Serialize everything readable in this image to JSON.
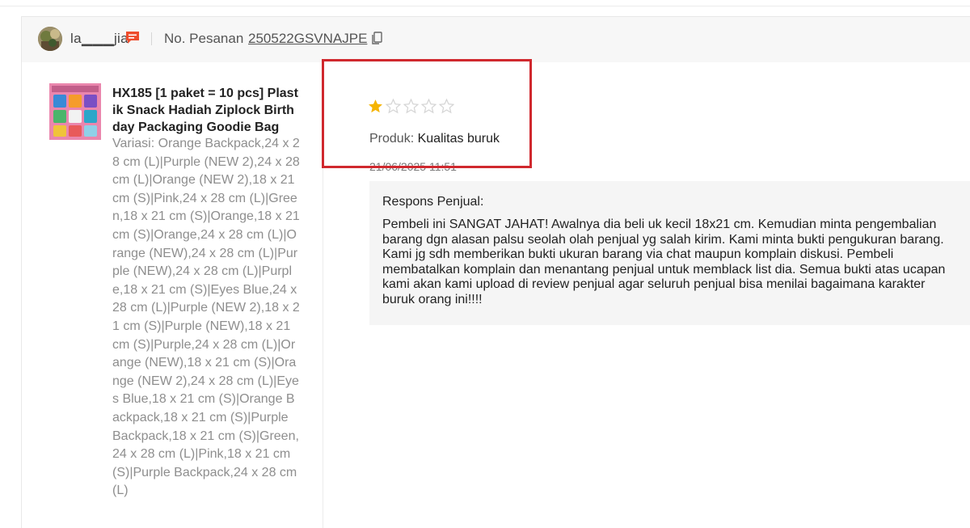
{
  "review": {
    "buyer": {
      "name": "la▁▁▁jia",
      "avatar_icon": "avatar-photo",
      "chat_icon": "chat-bubble-icon"
    },
    "order": {
      "label": "No. Pesanan",
      "number": "250522GSVNAJPE",
      "copy_icon": "copy-icon"
    },
    "product": {
      "title": "HX185 [1 paket = 10 pcs] Plastik Snack Hadiah Ziplock Birthday Packaging Goodie Bag",
      "variation": "Variasi: Orange Backpack,24 x 28 cm (L)|Purple (NEW 2),24 x 28 cm (L)|Orange (NEW 2),18 x 21 cm (S)|Pink,24 x 28 cm (L)|Green,18 x 21 cm (S)|Orange,18 x 21 cm (S)|Orange,24 x 28 cm (L)|Orange (NEW),24 x 28 cm (L)|Purple (NEW),24 x 28 cm (L)|Purple,18 x 21 cm (S)|Eyes Blue,24 x 28 cm (L)|Purple (NEW 2),18 x 21 cm (S)|Purple (NEW),18 x 21 cm (S)|Purple,24 x 28 cm (L)|Orange (NEW),18 x 21 cm (S)|Orange (NEW 2),24 x 28 cm (L)|Eyes Blue,18 x 21 cm (S)|Orange Backpack,18 x 21 cm (S)|Purple Backpack,18 x 21 cm (S)|Green,24 x 28 cm (L)|Pink,18 x 21 cm (S)|Purple Backpack,24 x 28 cm (L)"
    },
    "rating": {
      "stars": 1,
      "max_stars": 5,
      "label": "Produk:",
      "value": "Kualitas buruk",
      "timestamp": "21/06/2025 11:51"
    },
    "seller_response": {
      "title": "Respons Penjual:",
      "body": "Pembeli ini SANGAT JAHAT! Awalnya dia beli uk kecil 18x21 cm. Kemudian minta pengembalian barang dgn alasan palsu seolah olah penjual yg salah kirim. Kami minta bukti pengukuran barang. Kami jg sdh memberikan bukti ukuran barang via chat maupun komplain diskusi. Pembeli membatalkan komplain dan menantang penjual untuk memblack list dia. Semua bukti atas ucapan kami akan kami upload di review penjual agar seluruh penjual bisa menilai bagaimana karakter buruk orang ini!!!!"
    }
  },
  "colors": {
    "star_filled": "#f5b400",
    "star_empty": "#d5d5d5",
    "highlight": "#d0282e",
    "chat_icon": "#ee4d2d",
    "header_bg": "#f7f7f7",
    "response_bg": "#f5f5f5"
  }
}
